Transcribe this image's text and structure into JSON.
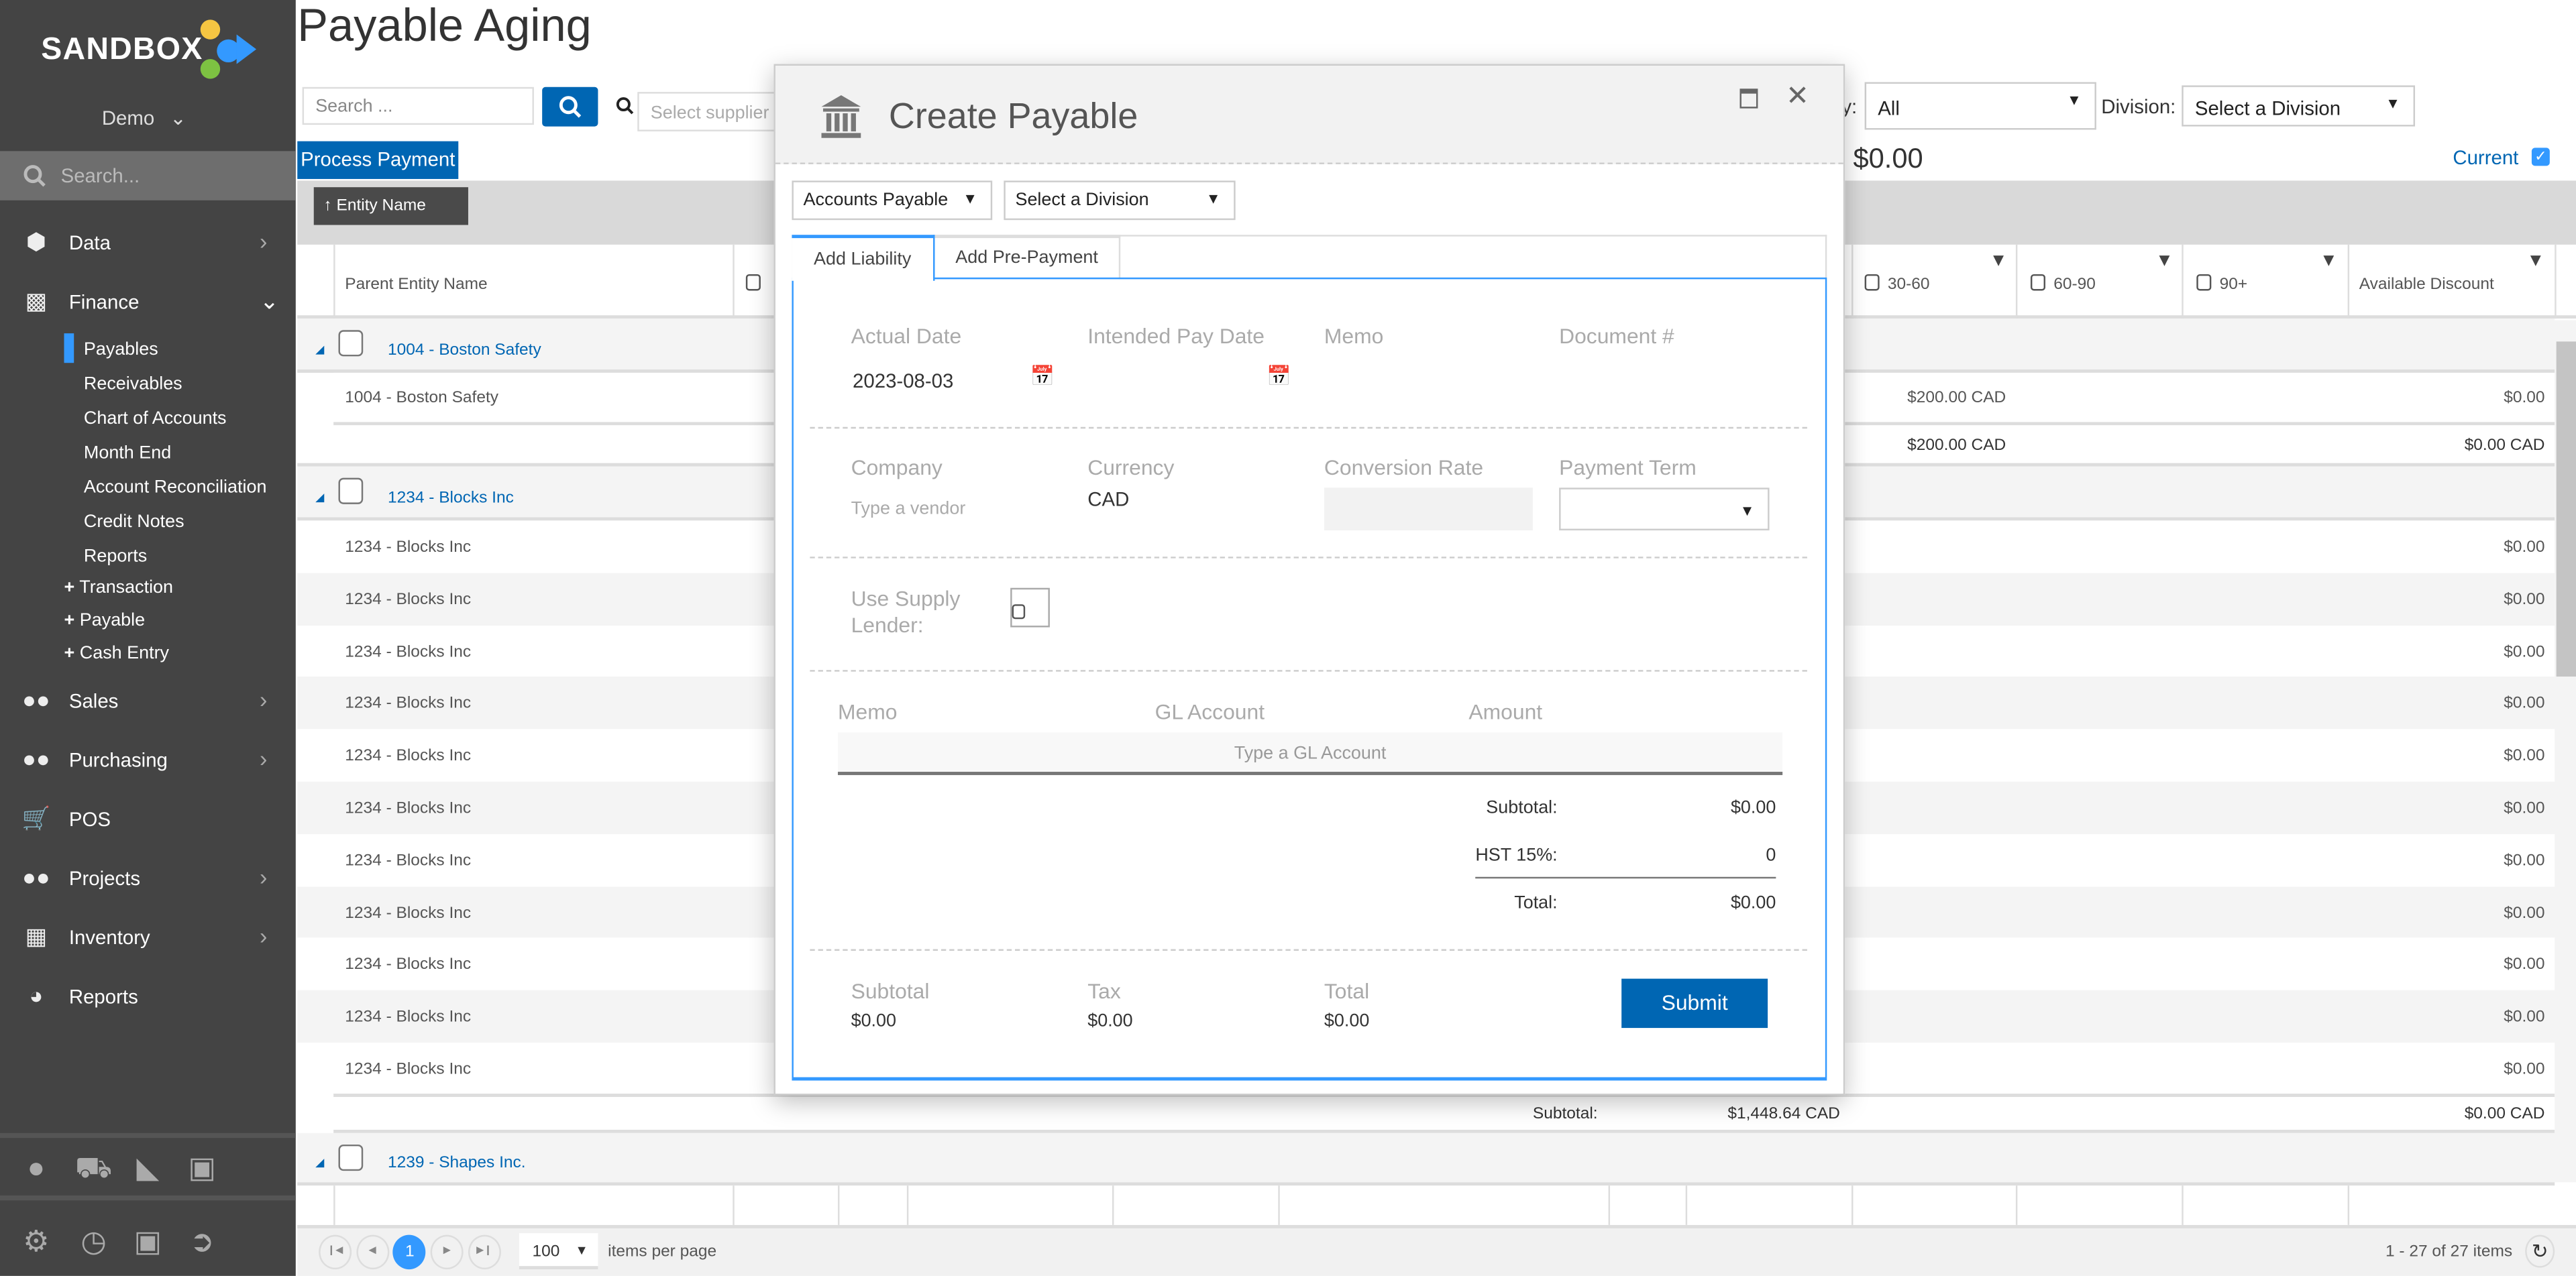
{
  "brand": {
    "logo_text": "SANDBOX",
    "colors": [
      "#f5c542",
      "#3399ff",
      "#7dc242"
    ]
  },
  "sidebar": {
    "org": "Demo",
    "search_placeholder": "Search...",
    "items": [
      {
        "label": "Data",
        "icon": "cube-icon"
      },
      {
        "label": "Finance",
        "icon": "money-icon",
        "expanded": true
      },
      {
        "label": "Sales",
        "icon": "users-icon"
      },
      {
        "label": "Purchasing",
        "icon": "users-icon"
      },
      {
        "label": "POS",
        "icon": "cart-icon"
      },
      {
        "label": "Projects",
        "icon": "users-icon"
      },
      {
        "label": "Inventory",
        "icon": "boxes-icon"
      },
      {
        "label": "Reports",
        "icon": "pie-chart-icon"
      }
    ],
    "finance_sub": [
      "Payables",
      "Receivables",
      "Chart of Accounts",
      "Month End",
      "Account Reconciliation",
      "Credit Notes",
      "Reports"
    ],
    "finance_add": [
      "Transaction",
      "Payable",
      "Cash Entry"
    ],
    "active_sub": "Payables",
    "accent": "#3399ff"
  },
  "page": {
    "title": "Payable Aging",
    "search_placeholder": "Search ...",
    "supplier_placeholder": "Select supplier",
    "filter_label_fragment": "y:",
    "filter_value": "All",
    "division_label": "Division:",
    "division_value": "Select a Division",
    "process_payment": "Process Payment",
    "total": "$0.00",
    "current_label": "Current",
    "current_checked": true,
    "group_chip": "Entity Name",
    "columns": {
      "parent": "Parent Entity Name",
      "c3060": "30-60",
      "c6090": "60-90",
      "c90": "90+",
      "discount": "Available Discount"
    },
    "groups": [
      {
        "name": "1004 - Boston Safety",
        "rows": [
          {
            "entity": "1004 - Boston Safety",
            "c3060": "$200.00 CAD",
            "discount": "$0.00"
          }
        ],
        "subtotal": {
          "c3060": "$200.00 CAD",
          "discount": "$0.00 CAD"
        }
      },
      {
        "name": "1234 - Blocks Inc",
        "rows": [
          {
            "entity": "1234 - Blocks Inc",
            "discount": "$0.00"
          },
          {
            "entity": "1234 - Blocks Inc",
            "discount": "$0.00"
          },
          {
            "entity": "1234 - Blocks Inc",
            "discount": "$0.00"
          },
          {
            "entity": "1234 - Blocks Inc",
            "discount": "$0.00"
          },
          {
            "entity": "1234 - Blocks Inc",
            "discount": "$0.00"
          },
          {
            "entity": "1234 - Blocks Inc",
            "discount": "$0.00"
          },
          {
            "entity": "1234 - Blocks Inc",
            "discount": "$0.00"
          },
          {
            "entity": "1234 - Blocks Inc",
            "discount": "$0.00"
          },
          {
            "entity": "1234 - Blocks Inc",
            "discount": "$0.00"
          },
          {
            "entity": "1234 - Blocks Inc",
            "discount": "$0.00"
          },
          {
            "entity": "1234 - Blocks Inc",
            "discount": "$0.00"
          }
        ],
        "subtotal": {
          "label": "Subtotal:",
          "amount": "$1,448.64 CAD",
          "discount": "$0.00 CAD"
        }
      },
      {
        "name": "1239 - Shapes Inc."
      }
    ],
    "pager": {
      "current_page": "1",
      "page_size": "100",
      "items_per_page": "items per page",
      "summary": "1 - 27 of 27 items"
    }
  },
  "modal": {
    "title": "Create Payable",
    "account": "Accounts Payable",
    "division": "Select a Division",
    "tabs": [
      "Add Liability",
      "Add Pre-Payment"
    ],
    "active_tab": "Add Liability",
    "fields": {
      "actual_date_label": "Actual Date",
      "actual_date": "2023-08-03",
      "intended_label": "Intended Pay Date",
      "memo_label": "Memo",
      "document_label": "Document #",
      "company_label": "Company",
      "company_placeholder": "Type a vendor",
      "currency_label": "Currency",
      "currency": "CAD",
      "conversion_label": "Conversion Rate",
      "term_label": "Payment Term",
      "supply_label_1": "Use Supply",
      "supply_label_2": "Lender:"
    },
    "lines": {
      "memo": "Memo",
      "gl": "GL Account",
      "amount": "Amount",
      "gl_placeholder": "Type a GL Account"
    },
    "totals": {
      "subtotal_label": "Subtotal:",
      "subtotal": "$0.00",
      "hst_label": "HST 15%:",
      "hst": "0",
      "total_label": "Total:",
      "total": "$0.00"
    },
    "footer": {
      "subtotal_label": "Subtotal",
      "subtotal": "$0.00",
      "tax_label": "Tax",
      "tax": "$0.00",
      "total_label": "Total",
      "total": "$0.00"
    },
    "submit": "Submit"
  }
}
